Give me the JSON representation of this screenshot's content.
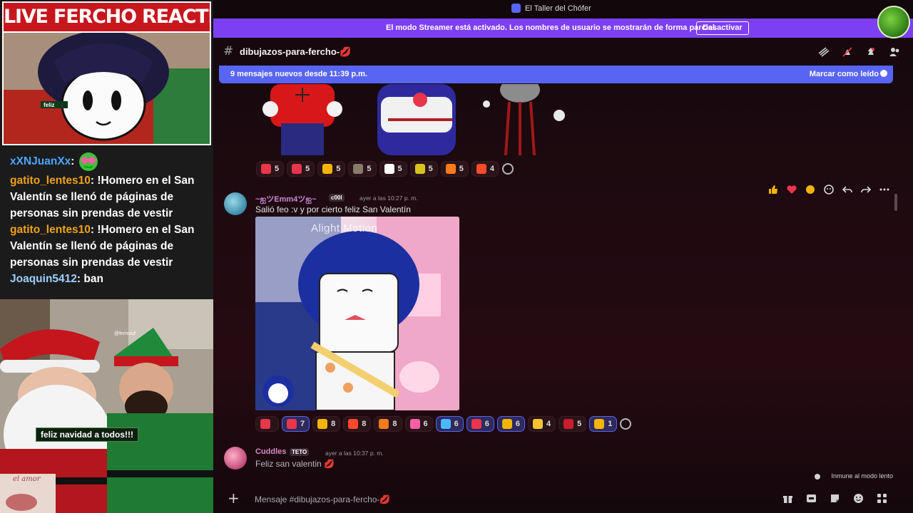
{
  "stream": {
    "banner": "LIVE FERCHO REACTION",
    "chat": [
      {
        "user": "xXNJuanXx",
        "sep": ":",
        "text": ""
      },
      {
        "user": "gatito_lentes10",
        "sep": ":",
        "text": " !Homero en el San Valentín se llenó de páginas de personas sin prendas de vestir"
      },
      {
        "user": "gatito_lentes10",
        "sep": ":",
        "text": " !Homero en el San Valentín se llenó de páginas de personas sin prendas de vestir"
      },
      {
        "user": "Joaquin5412",
        "sep": ":",
        "text": " ban"
      }
    ],
    "cam_caption": "feliz navidad a todos!!!",
    "toon_caption": "feliz",
    "cam_thumb_text": "el amor",
    "cam_tag": "@fernsiuf"
  },
  "discord": {
    "window_title": "El Taller del Chófer",
    "streamer": {
      "text": "El modo Streamer está activado. Los nombres de usuario se mostrarán de forma parcial.",
      "button": "Desactivar"
    },
    "channel": {
      "hash": "#",
      "name": "dibujazos-para-fercho-💋",
      "tools": [
        "threads-icon",
        "mute-icon",
        "pin-icon",
        "members-icon"
      ]
    },
    "new_messages": {
      "text": "9 mensajes nuevos desde 11:39 p.m.",
      "action": "Marcar como leído"
    },
    "top_reactions": [
      {
        "emoji": "heart-eyes",
        "color": "#e8364a",
        "count": "5",
        "mine": false
      },
      {
        "emoji": "heart",
        "color": "#e8364a",
        "count": "5",
        "mine": false
      },
      {
        "emoji": "flex",
        "color": "#f4b400",
        "count": "5",
        "mine": false
      },
      {
        "emoji": "moai",
        "color": "#8a7a6a",
        "count": "5",
        "mine": false
      },
      {
        "emoji": "eyes",
        "color": "#ffffff",
        "count": "5",
        "mine": false
      },
      {
        "emoji": "cat-face",
        "color": "#d8c21e",
        "count": "5",
        "mine": false
      },
      {
        "emoji": "fire",
        "color": "#ff7a1a",
        "count": "5",
        "mine": false
      },
      {
        "emoji": "fire-heart",
        "color": "#ff4a2a",
        "count": "4",
        "mine": false
      }
    ],
    "message1": {
      "author": "~ஐツEmm4ツஐ~",
      "tag": "c00l",
      "time": "ayer a las 10:27 p. m.",
      "text": "Salió feo :v y por cierto feliz San Valentín",
      "image_watermark": "Alight Motion",
      "reactions": [
        {
          "emoji": "heart-eyes",
          "color": "#e8364a",
          "count": "",
          "mine": false
        },
        {
          "emoji": "heart",
          "color": "#e8364a",
          "count": "7",
          "mine": true
        },
        {
          "emoji": "flex",
          "color": "#f4b400",
          "count": "8",
          "mine": false
        },
        {
          "emoji": "fire-heart",
          "color": "#ff4a2a",
          "count": "8",
          "mine": false
        },
        {
          "emoji": "fire",
          "color": "#ff7a1a",
          "count": "8",
          "mine": false
        },
        {
          "emoji": "pink-heart",
          "color": "#ff5fa2",
          "count": "6",
          "mine": false
        },
        {
          "emoji": "gem",
          "color": "#4ab8ff",
          "count": "6",
          "mine": true
        },
        {
          "emoji": "love-letter",
          "color": "#e8364a",
          "count": "6",
          "mine": true
        },
        {
          "emoji": "sun",
          "color": "#f4b400",
          "count": "6",
          "mine": true
        },
        {
          "emoji": "crown",
          "color": "#f4c430",
          "count": "4",
          "mine": false
        },
        {
          "emoji": "heart",
          "color": "#c81e2e",
          "count": "5",
          "mine": false
        },
        {
          "emoji": "thumbs-up",
          "color": "#f4b400",
          "count": "1",
          "mine": true
        }
      ],
      "actions": [
        "thumbs-up-icon",
        "heart-icon",
        "flex-icon",
        "add-reaction-icon",
        "reply-icon",
        "forward-icon",
        "more-icon"
      ]
    },
    "message2": {
      "author": "Cuddles",
      "tag": "TETO",
      "time": "ayer a las 10:37 p. m.",
      "text": "Feliz san valentin 💋"
    },
    "slow_mode": "Inmune al modo lento",
    "composer": {
      "plus": "+",
      "placeholder": "Mensaje #dibujazos-para-fercho-💋",
      "tools": [
        "gift-icon",
        "gif-icon",
        "sticker-icon",
        "emoji-icon",
        "apps-icon"
      ]
    }
  }
}
